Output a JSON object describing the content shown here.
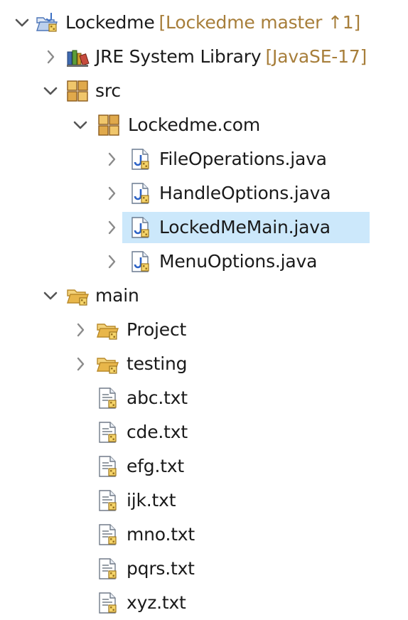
{
  "tree": {
    "project": {
      "label": "Lockedme",
      "decoration": "[Lockedme master ↑1]"
    },
    "jre": {
      "label": "JRE System Library",
      "decoration": "[JavaSE-17]"
    },
    "src": {
      "label": "src"
    },
    "package": {
      "label": "Lockedme.com"
    },
    "java_files": [
      {
        "label": "FileOperations.java"
      },
      {
        "label": "HandleOptions.java"
      },
      {
        "label": "LockedMeMain.java"
      },
      {
        "label": "MenuOptions.java"
      }
    ],
    "main": {
      "label": "main"
    },
    "folders": [
      {
        "label": "Project"
      },
      {
        "label": "testing"
      }
    ],
    "text_files": [
      {
        "label": "abc.txt"
      },
      {
        "label": "cde.txt"
      },
      {
        "label": "efg.txt"
      },
      {
        "label": "ijk.txt"
      },
      {
        "label": "mno.txt"
      },
      {
        "label": "pqrs.txt"
      },
      {
        "label": "xyz.txt"
      }
    ]
  },
  "colors": {
    "selection": "#cce8fb",
    "decoration": "#a77e3a",
    "chevron": "#6b6b6b",
    "folder": "#e8b64a"
  },
  "selected_item": "LockedMeMain.java"
}
